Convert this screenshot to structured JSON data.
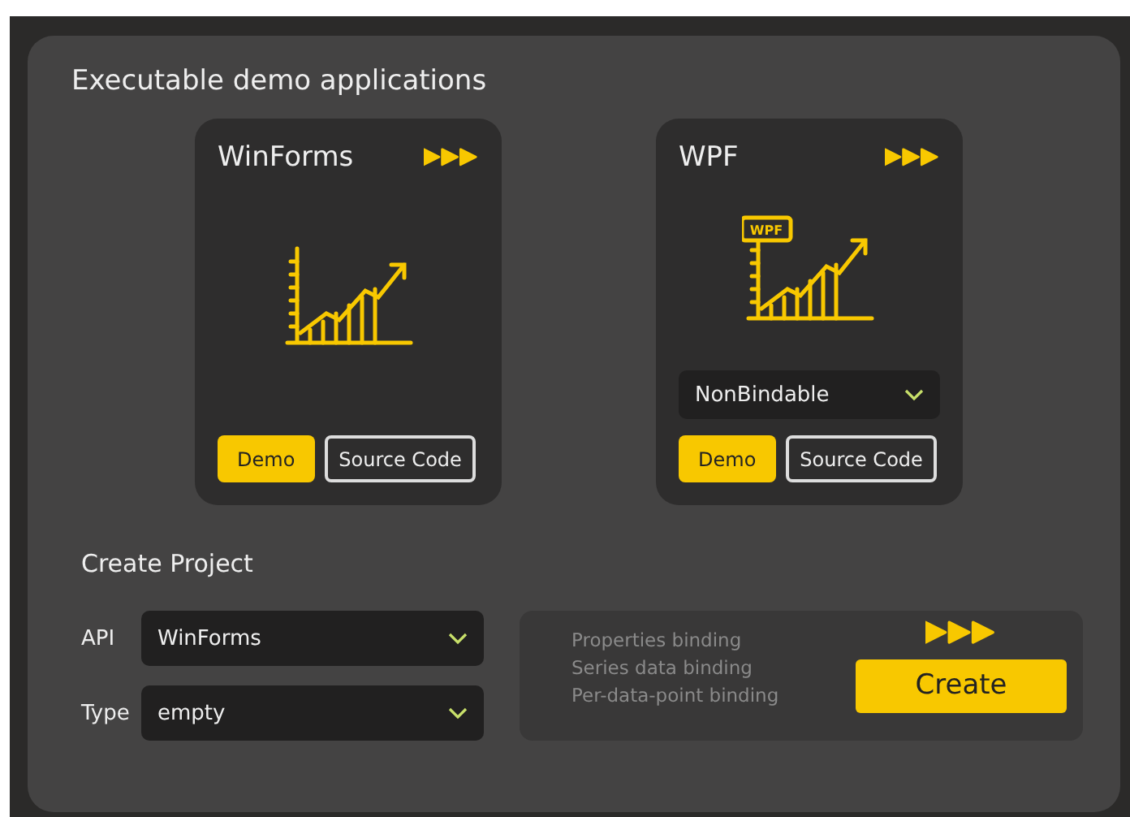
{
  "demos": {
    "title": "Executable demo applications",
    "apps": [
      {
        "name": "WinForms",
        "buttons": [
          {
            "label": "Demo",
            "kind": "primary"
          },
          {
            "label": "Source Code",
            "kind": "outline"
          }
        ]
      },
      {
        "name": "WPF",
        "sign_label": "WPF",
        "dropdown": {
          "value": "NonBindable"
        },
        "buttons": [
          {
            "label": "Demo",
            "kind": "primary"
          },
          {
            "label": "Source Code",
            "kind": "outline"
          }
        ]
      }
    ]
  },
  "create_project": {
    "title": "Create Project",
    "fields": [
      {
        "label": "API",
        "value": "WinForms"
      },
      {
        "label": "Type",
        "value": "empty"
      }
    ],
    "bindings": [
      "Properties binding",
      "Series data binding",
      "Per-data-point binding"
    ],
    "button": "Create"
  }
}
